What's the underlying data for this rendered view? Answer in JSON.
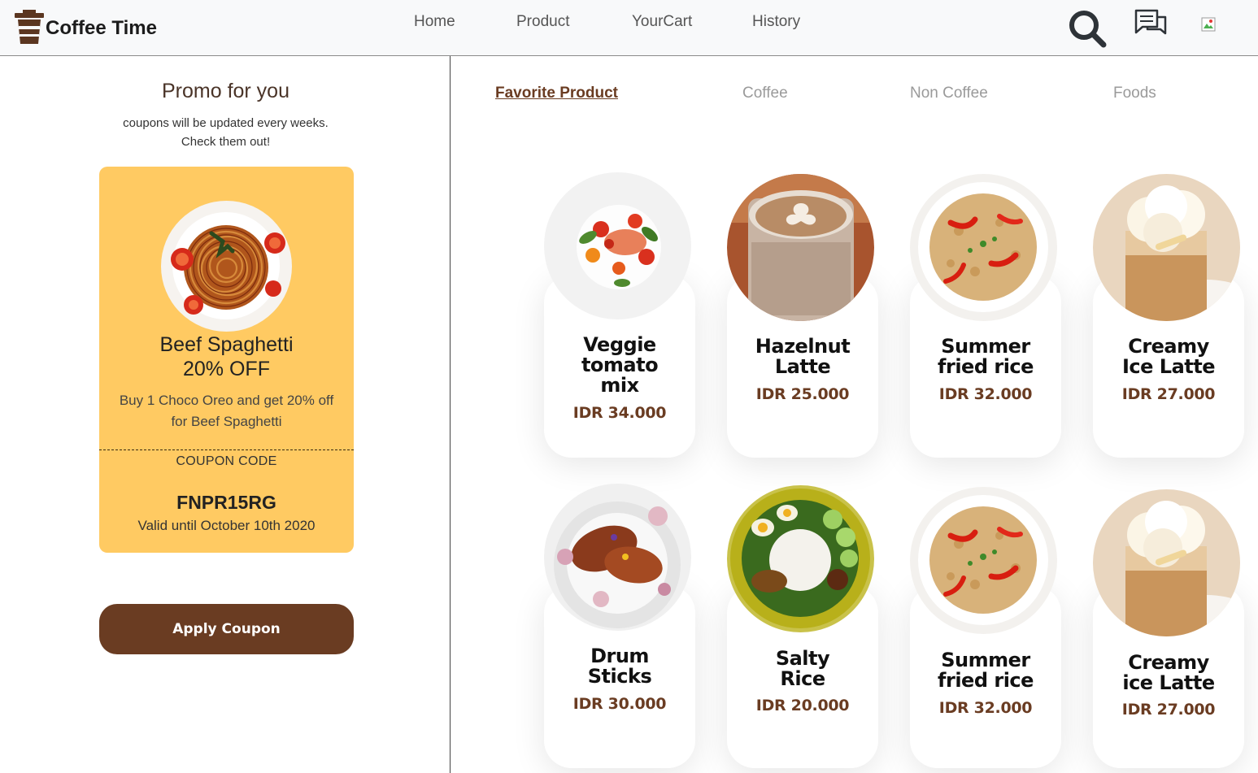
{
  "header": {
    "brand": "Coffee Time",
    "nav": [
      {
        "label": "Home"
      },
      {
        "label": "Product"
      },
      {
        "label": "YourCart"
      },
      {
        "label": "History"
      }
    ],
    "icons": {
      "search": "search-icon",
      "chat": "chat-icon",
      "profile": "profile-image-icon"
    }
  },
  "promo": {
    "title": "Promo for you",
    "subtitle_line1": "coupons will be updated every weeks.",
    "subtitle_line2": "Check them out!",
    "coupon": {
      "name": "Beef Spaghetti",
      "discount": "20% OFF",
      "desc_line1": "Buy 1 Choco Oreo and get 20% off",
      "desc_line2": "for Beef Spaghetti",
      "code_label": "COUPON CODE",
      "code": "FNPR15RG",
      "valid": "Valid until October 10th 2020"
    },
    "apply_label": "Apply Coupon"
  },
  "tabs": [
    {
      "label": "Favorite Product",
      "active": true
    },
    {
      "label": "Coffee",
      "active": false
    },
    {
      "label": "Non Coffee",
      "active": false
    },
    {
      "label": "Foods",
      "active": false
    }
  ],
  "products": [
    {
      "name_lines": [
        "Veggie",
        "tomato",
        "mix"
      ],
      "price": "IDR 34.000",
      "photo": "veggie-tomato-mix-photo"
    },
    {
      "name_lines": [
        "Hazelnut",
        "Latte"
      ],
      "price": "IDR 25.000",
      "photo": "hazelnut-latte-photo"
    },
    {
      "name_lines": [
        "Summer",
        "fried rice"
      ],
      "price": "IDR 32.000",
      "photo": "summer-fried-rice-photo"
    },
    {
      "name_lines": [
        "Creamy",
        "Ice Latte"
      ],
      "price": "IDR 27.000",
      "photo": "creamy-ice-latte-photo"
    },
    {
      "name_lines": [
        "Drum",
        "Sticks"
      ],
      "price": "IDR 30.000",
      "photo": "drum-sticks-photo"
    },
    {
      "name_lines": [
        "Salty",
        "Rice"
      ],
      "price": "IDR 20.000",
      "photo": "salty-rice-photo"
    },
    {
      "name_lines": [
        "Summer",
        "fried rice"
      ],
      "price": "IDR 32.000",
      "photo": "summer-fried-rice-photo"
    },
    {
      "name_lines": [
        "Creamy",
        "ice Latte"
      ],
      "price": "IDR 27.000",
      "photo": "creamy-ice-latte-photo"
    }
  ],
  "colors": {
    "accent": "#6a3c22",
    "coupon_bg": "#ffca62",
    "header_bg": "#f8f9fa"
  }
}
